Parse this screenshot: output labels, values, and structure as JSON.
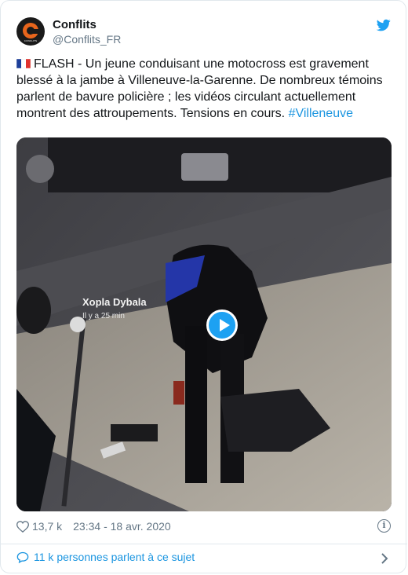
{
  "author": {
    "name": "Conflits",
    "handle": "@Conflits_FR",
    "avatar_text": "CONFLITS",
    "avatar_color": "#e8651c"
  },
  "tweet": {
    "flag_icon": "france-flag-icon",
    "text": "FLASH - Un jeune conduisant une motocross est gravement blessé à la jambe à Villeneuve-la-Garenne. De nombreux témoins parlent de bavure policière ; les vidéos circulant actuellement montrent des attroupements. Tensions en cours. ",
    "hashtag": "#Villeneuve"
  },
  "video": {
    "overlay_name": "Xopla Dybala",
    "overlay_time": "Il y a 25 min",
    "play_icon": "play-icon"
  },
  "stats": {
    "likes": "13,7 k",
    "timestamp": "23:34 - 18 avr. 2020"
  },
  "footer": {
    "conversation": "11 k personnes parlent à ce sujet"
  },
  "colors": {
    "link": "#1b95e0",
    "twitter_blue": "#1da1f2",
    "muted": "#657786",
    "border": "#e1e8ed"
  }
}
